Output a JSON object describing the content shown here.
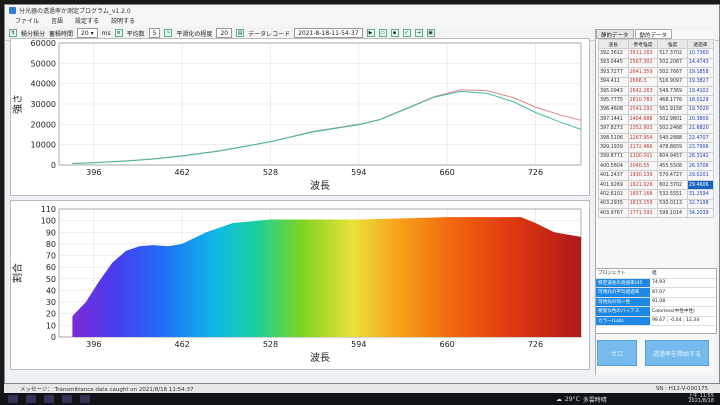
{
  "window": {
    "title": "分光器の透過率か測定プログラム_v1.2.0"
  },
  "menu": {
    "items": [
      "ファイル",
      "言語",
      "設定する",
      "説明する"
    ]
  },
  "toolbar": {
    "gain_label": "積分積分",
    "integration_label": "蓄積時間",
    "integration_value": "20",
    "unit": "ms",
    "average_label": "平均数",
    "average_value": "5",
    "smooth_label": "平滑化の程度",
    "smooth_value": "20",
    "record_label": "データレコード",
    "record_value": "2021-8-18-11-54-37"
  },
  "colors": {
    "reference_line": "#d98a8a",
    "sample_line": "#3bbfa6",
    "accent": "#1e88e5"
  },
  "chart_data": [
    {
      "type": "line",
      "ylabel": "強さ",
      "xlabel": "波長",
      "xlim": [
        370,
        760
      ],
      "ylim": [
        0,
        60000
      ],
      "x_ticks": [
        396,
        462,
        528,
        594,
        660,
        726
      ],
      "y_ticks": [
        0,
        10000,
        20000,
        30000,
        40000,
        50000,
        60000
      ],
      "grid": true,
      "series": [
        {
          "x": [
            380,
            396,
            420,
            440,
            462,
            490,
            528,
            560,
            594,
            610,
            630,
            650,
            670,
            690,
            710,
            726,
            745,
            760
          ],
          "y": [
            800,
            1200,
            2000,
            3000,
            4500,
            7000,
            11500,
            16500,
            20000,
            22500,
            28000,
            33500,
            37000,
            36500,
            33000,
            28500,
            24500,
            22000
          ]
        },
        {
          "x": [
            380,
            396,
            420,
            440,
            462,
            490,
            528,
            560,
            594,
            610,
            630,
            650,
            670,
            690,
            710,
            726,
            745,
            760
          ],
          "y": [
            700,
            1100,
            1900,
            2900,
            4400,
            6900,
            11400,
            16300,
            19800,
            22300,
            27800,
            33300,
            36200,
            35200,
            31000,
            25800,
            21000,
            17500
          ]
        }
      ]
    },
    {
      "type": "area",
      "ylabel": "割合",
      "xlabel": "波長",
      "xlim": [
        370,
        760
      ],
      "ylim": [
        0,
        110
      ],
      "x_ticks": [
        396,
        462,
        528,
        594,
        660,
        726
      ],
      "y_ticks": [
        0,
        10,
        20,
        30,
        40,
        50,
        60,
        70,
        80,
        90,
        100,
        110
      ],
      "grid": true,
      "fill": "visible-spectrum",
      "series": [
        {
          "x": [
            380,
            390,
            400,
            410,
            420,
            430,
            440,
            452,
            462,
            480,
            500,
            528,
            560,
            594,
            630,
            660,
            690,
            715,
            726,
            740,
            760
          ],
          "y": [
            18,
            30,
            48,
            64,
            74,
            78,
            79,
            78,
            80,
            90,
            98,
            101,
            101,
            101,
            102,
            103,
            103,
            103,
            98,
            90,
            86
          ]
        }
      ]
    }
  ],
  "right_panel": {
    "tabs": [
      "静的データ",
      "動的データ"
    ],
    "columns": [
      "波長",
      "参考強度",
      "強度",
      "透過率"
    ],
    "rows": [
      [
        "392.3612",
        "3511.163",
        "517.3702",
        "10.7360"
      ],
      [
        "393.0445",
        "2567.302",
        "502.2067",
        "14.4743"
      ],
      [
        "393.7277",
        "2641.359",
        "502.7667",
        "19.1858"
      ],
      [
        "394.411",
        "2666.3",
        "516.9097",
        "19.3827"
      ],
      [
        "395.0943",
        "2642.263",
        "549.7369",
        "19.4102"
      ],
      [
        "395.7775",
        "2610.783",
        "468.1776",
        "18.0129"
      ],
      [
        "396.4608",
        "2541.191",
        "561.9158",
        "19.7020"
      ],
      [
        "397.1441",
        "2464.688",
        "502.9801",
        "20.3800"
      ],
      [
        "397.8273",
        "2352.903",
        "502.2468",
        "21.6820"
      ],
      [
        "398.5106",
        "2267.954",
        "540.2888",
        "22.4707"
      ],
      [
        "399.1939",
        "2172.466",
        "478.8659",
        "23.7906"
      ],
      [
        "399.8771",
        "2100.001",
        "604.9457",
        "26.3142"
      ],
      [
        "400.5604",
        "2040.55",
        "455.5508",
        "26.3706"
      ],
      [
        "401.2437",
        "1930.139",
        "570.4727",
        "29.0201"
      ],
      [
        "401.9269",
        "1921.026",
        "602.3702",
        "29.4606"
      ],
      [
        "402.6102",
        "1857.168",
        "532.5551",
        "31.2594"
      ],
      [
        "403.2935",
        "1813.159",
        "530.0113",
        "32.7198"
      ],
      [
        "403.9767",
        "1771.593",
        "599.1014",
        "34.2039"
      ]
    ],
    "selected_row": 14
  },
  "properties": {
    "header": [
      "プロジェクト",
      "値"
    ],
    "rows": [
      [
        "特定波長の透過率(45",
        "74.93"
      ],
      [
        "可視光の平均透過率",
        "87.07"
      ],
      [
        "可視光の均一性",
        "91.08"
      ],
      [
        "視覚な色のバイアス",
        "Colorless(中性中性)"
      ],
      [
        "カラー(Lab)",
        "99.67 ; -0.04 ; 12.34"
      ]
    ]
  },
  "buttons": {
    "zero": "ゼロ",
    "measure": "透過率を開始する"
  },
  "status": {
    "message": "メッセージ： Transmittance data caught on 2021/8/18 11:54:37",
    "sn": "SN : H12-V-000175"
  },
  "taskbar": {
    "temp": "29°C",
    "weather": "多雲時晴",
    "time": "上午 11:55",
    "date": "2021/8/18"
  }
}
